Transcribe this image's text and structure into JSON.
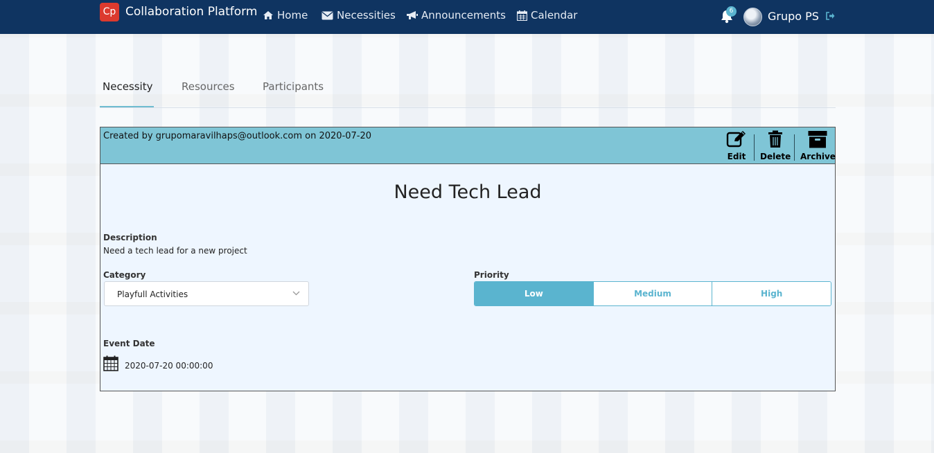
{
  "navbar": {
    "logo_text": "Cp",
    "brand": "Collaboration Platform",
    "links": [
      {
        "label": "Home",
        "icon": "home-icon"
      },
      {
        "label": "Necessities",
        "icon": "envelope-icon"
      },
      {
        "label": "Announcements",
        "icon": "bullhorn-icon"
      },
      {
        "label": "Calendar",
        "icon": "calendar-icon"
      }
    ],
    "notification_count": "6",
    "user_name": "Grupo PS"
  },
  "tabs": [
    {
      "label": "Necessity",
      "active": true
    },
    {
      "label": "Resources",
      "active": false
    },
    {
      "label": "Participants",
      "active": false
    }
  ],
  "card": {
    "created_text": "Created by grupomaravilhaps@outlook.com on 2020-07-20",
    "actions": {
      "edit": "Edit",
      "delete": "Delete",
      "archive": "Archive"
    },
    "title": "Need Tech Lead",
    "description_label": "Description",
    "description": "Need a tech lead for a new project",
    "category_label": "Category",
    "category_value": "Playfull Activities",
    "priority_label": "Priority",
    "priority_options": [
      "Low",
      "Medium",
      "High"
    ],
    "priority_selected": "Low",
    "event_date_label": "Event Date",
    "event_date": "2020-07-20 00:00:00"
  },
  "colors": {
    "navbar": "#0f3461",
    "card_header": "#7fc5d6",
    "accent": "#5ab4cf",
    "logo": "#dc3a2e"
  }
}
